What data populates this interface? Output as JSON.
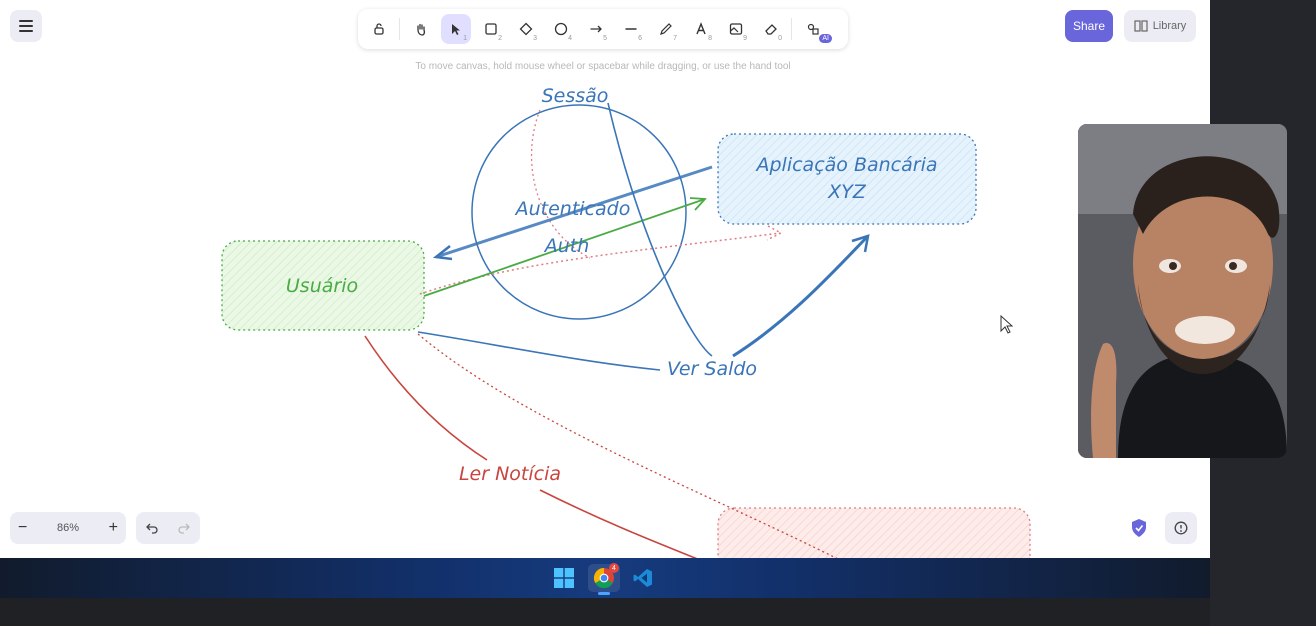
{
  "app": {
    "toolbar": {
      "tools": [
        {
          "name": "lock",
          "key": ""
        },
        {
          "name": "hand",
          "key": ""
        },
        {
          "name": "selection",
          "key": "1",
          "active": true
        },
        {
          "name": "rectangle",
          "key": "2"
        },
        {
          "name": "diamond",
          "key": "3"
        },
        {
          "name": "ellipse",
          "key": "4"
        },
        {
          "name": "arrow",
          "key": "5"
        },
        {
          "name": "line",
          "key": "6"
        },
        {
          "name": "draw",
          "key": "7"
        },
        {
          "name": "text",
          "key": "8"
        },
        {
          "name": "image",
          "key": "9"
        },
        {
          "name": "eraser",
          "key": "0"
        },
        {
          "name": "extra-tools",
          "badge": "AI"
        }
      ]
    },
    "hint": "To move canvas, hold mouse wheel or spacebar while dragging, or use the hand tool",
    "share_label": "Share",
    "library_label": "Library",
    "zoom_level": "86%"
  },
  "canvas": {
    "labels": {
      "sessao": "Sessão",
      "autenticado": "Autenticado",
      "auth": "Auth",
      "usuario": "Usuário",
      "aplicacao_line1": "Aplicação Bancária",
      "aplicacao_line2": "XYZ",
      "ver_saldo": "Ver Saldo",
      "ler_noticia": "Ler Notícia"
    },
    "colors": {
      "blue": "#3a75b8",
      "green": "#4aab45",
      "red": "#c9453f",
      "pink": "#e07d83",
      "green_fill": "#ebf8e6",
      "blue_fill": "#e7f3fc",
      "red_fill": "#fdecea"
    }
  },
  "taskbar": {
    "apps": [
      "windows-start",
      "chrome",
      "vscode"
    ],
    "chrome_badge": "4"
  }
}
